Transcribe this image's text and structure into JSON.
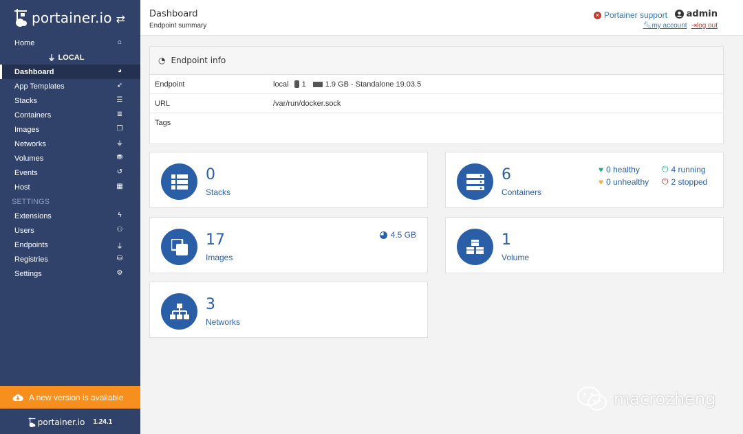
{
  "sidebar": {
    "brand": "portainer.io",
    "home_label": "Home",
    "endpoint_name": "LOCAL",
    "items": [
      {
        "label": "Dashboard",
        "icon": "dashboard-icon"
      },
      {
        "label": "App Templates",
        "icon": "rocket-icon"
      },
      {
        "label": "Stacks",
        "icon": "th-list-icon"
      },
      {
        "label": "Containers",
        "icon": "server-icon"
      },
      {
        "label": "Images",
        "icon": "clone-icon"
      },
      {
        "label": "Networks",
        "icon": "sitemap-icon"
      },
      {
        "label": "Volumes",
        "icon": "cubes-icon"
      },
      {
        "label": "Events",
        "icon": "history-icon"
      },
      {
        "label": "Host",
        "icon": "th-icon"
      }
    ],
    "settings_heading": "SETTINGS",
    "settings_items": [
      {
        "label": "Extensions",
        "icon": "bolt-icon"
      },
      {
        "label": "Users",
        "icon": "users-icon"
      },
      {
        "label": "Endpoints",
        "icon": "plug-icon"
      },
      {
        "label": "Registries",
        "icon": "database-icon"
      },
      {
        "label": "Settings",
        "icon": "cogs-icon"
      }
    ],
    "update_banner": "A new version is available",
    "footer_brand": "portainer.io",
    "version": "1.24.1"
  },
  "header": {
    "title": "Dashboard",
    "subtitle": "Endpoint summary",
    "support": "Portainer support",
    "user": "admin",
    "my_account": "my account",
    "log_out": "log out"
  },
  "endpoint_info": {
    "heading": "Endpoint info",
    "rows": {
      "endpoint_key": "Endpoint",
      "endpoint_name": "local",
      "cpu": "1",
      "memory": "1.9 GB - Standalone 19.03.5",
      "url_key": "URL",
      "url": "/var/run/docker.sock",
      "tags_key": "Tags"
    }
  },
  "widgets": {
    "stacks": {
      "count": "0",
      "label": "Stacks"
    },
    "containers": {
      "count": "6",
      "label": "Containers",
      "healthy": "0 healthy",
      "unhealthy": "0 unhealthy",
      "running": "4 running",
      "stopped": "2 stopped"
    },
    "images": {
      "count": "17",
      "label": "Images",
      "size": "4.5 GB"
    },
    "volumes": {
      "count": "1",
      "label": "Volume"
    },
    "networks": {
      "count": "3",
      "label": "Networks"
    }
  },
  "colors": {
    "sidebar": "#30426a",
    "accent": "#2a5fa8",
    "banner": "#f78f1e",
    "healthy": "#23ae89",
    "unhealthy": "#f0ad4e",
    "running": "#23ae89",
    "stopped": "#c0392b"
  },
  "watermark": "macrozheng"
}
